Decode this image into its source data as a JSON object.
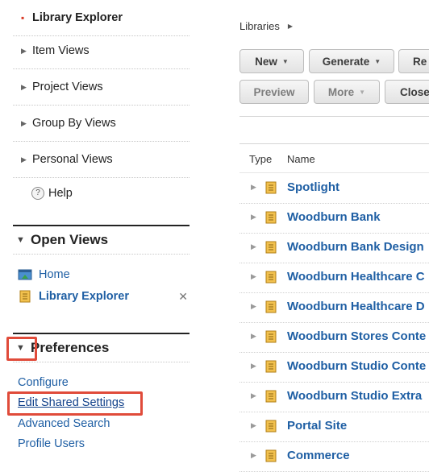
{
  "nav": {
    "items": [
      {
        "label": "Library Explorer",
        "active": true
      },
      {
        "label": "Item Views"
      },
      {
        "label": "Project Views"
      },
      {
        "label": "Group By Views"
      },
      {
        "label": "Personal Views"
      }
    ],
    "help_label": "Help"
  },
  "open_views": {
    "title": "Open Views",
    "items": [
      {
        "label": "Home",
        "icon": "home-icon"
      },
      {
        "label": "Library Explorer",
        "icon": "library-icon",
        "close": "✕"
      }
    ]
  },
  "preferences": {
    "title": "Preferences",
    "links": [
      "Configure",
      "Edit Shared Settings",
      "Advanced Search",
      "Profile Users"
    ]
  },
  "breadcrumb": {
    "label": "Libraries"
  },
  "toolbar": {
    "row1": [
      {
        "label": "New",
        "dropdown": true
      },
      {
        "label": "Generate",
        "dropdown": true
      },
      {
        "label": "Re"
      }
    ],
    "row2": [
      {
        "label": "Preview"
      },
      {
        "label": "More",
        "dropdown": true
      },
      {
        "label": "Close"
      }
    ]
  },
  "table": {
    "headers": {
      "type": "Type",
      "name": "Name"
    },
    "rows": [
      "Spotlight",
      "Woodburn Bank",
      "Woodburn Bank Design",
      "Woodburn Healthcare C",
      "Woodburn Healthcare D",
      "Woodburn Stores Conte",
      "Woodburn Studio Conte",
      "Woodburn Studio Extra",
      "Portal Site",
      "Commerce"
    ]
  },
  "colors": {
    "link": "#1f5fa4",
    "highlight": "#e04b3a",
    "active_marker": "#d93a26"
  }
}
